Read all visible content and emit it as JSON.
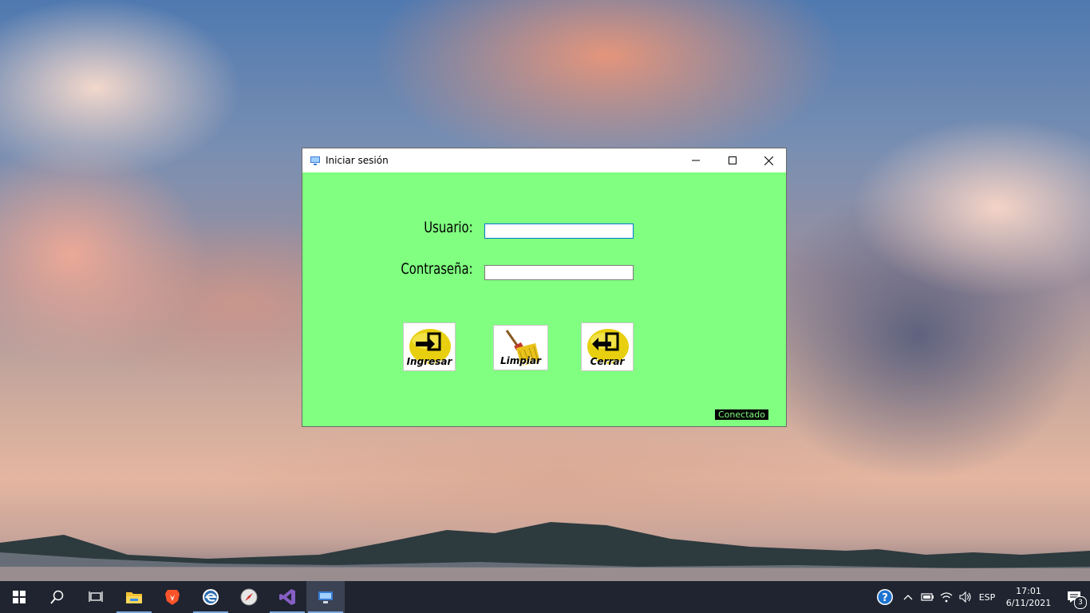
{
  "window": {
    "title": "Iniciar sesión",
    "background": "#80ff80"
  },
  "form": {
    "usuario_label": "Usuario:",
    "usuario_value": "",
    "password_label": "Contraseña:",
    "password_value": ""
  },
  "buttons": {
    "ingresar": "Ingresar",
    "limpiar": "Limpiar",
    "cerrar": "Cerrar"
  },
  "status": {
    "text": "Conectado"
  },
  "taskbar": {
    "apps": [
      "start-icon",
      "search-icon",
      "task-view-icon",
      "file-explorer-icon",
      "brave-browser-icon",
      "edge-icon",
      "compass-icon",
      "visual-studio-icon",
      "login-app-icon"
    ],
    "language": "ESP",
    "time": "17:01",
    "date": "6/11/2021",
    "notification_count": "3"
  }
}
